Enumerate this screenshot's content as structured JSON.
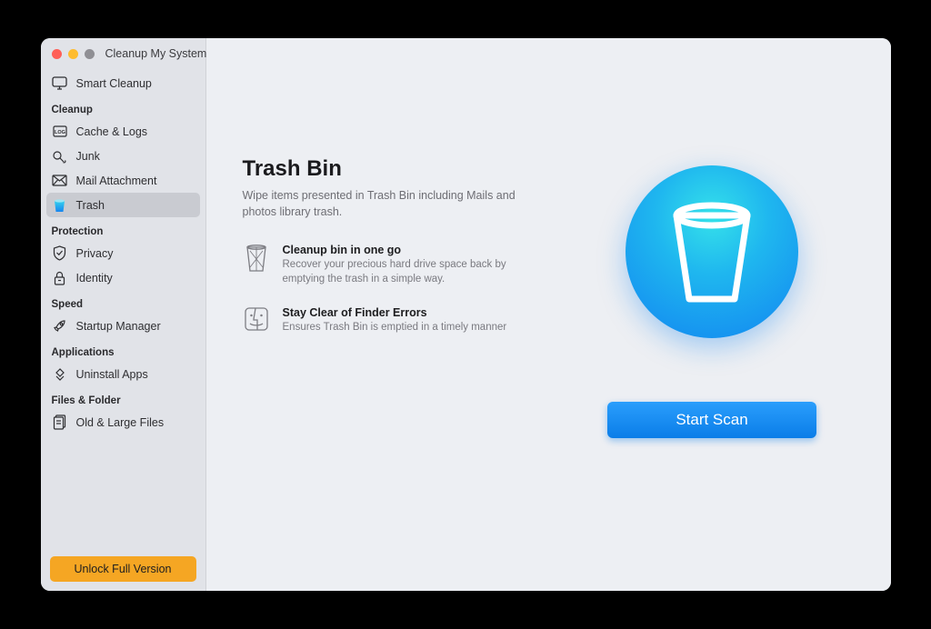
{
  "app": {
    "title": "Cleanup My System"
  },
  "sidebar": {
    "top_item": {
      "label": "Smart Cleanup"
    },
    "sections": [
      {
        "header": "Cleanup",
        "items": [
          {
            "label": "Cache & Logs"
          },
          {
            "label": "Junk"
          },
          {
            "label": "Mail Attachment"
          },
          {
            "label": "Trash"
          }
        ]
      },
      {
        "header": "Protection",
        "items": [
          {
            "label": "Privacy"
          },
          {
            "label": "Identity"
          }
        ]
      },
      {
        "header": "Speed",
        "items": [
          {
            "label": "Startup Manager"
          }
        ]
      },
      {
        "header": "Applications",
        "items": [
          {
            "label": "Uninstall Apps"
          }
        ]
      },
      {
        "header": "Files & Folder",
        "items": [
          {
            "label": "Old & Large Files"
          }
        ]
      }
    ],
    "unlock_label": "Unlock Full Version"
  },
  "main": {
    "title": "Trash Bin",
    "subtitle": "Wipe items presented in Trash Bin including Mails and photos library trash.",
    "features": [
      {
        "title": "Cleanup bin in one go",
        "desc": "Recover your precious hard drive space back by emptying the trash in a simple way."
      },
      {
        "title": "Stay Clear of Finder Errors",
        "desc": "Ensures Trash Bin is emptied in a timely manner"
      }
    ],
    "scan_button": "Start Scan"
  }
}
